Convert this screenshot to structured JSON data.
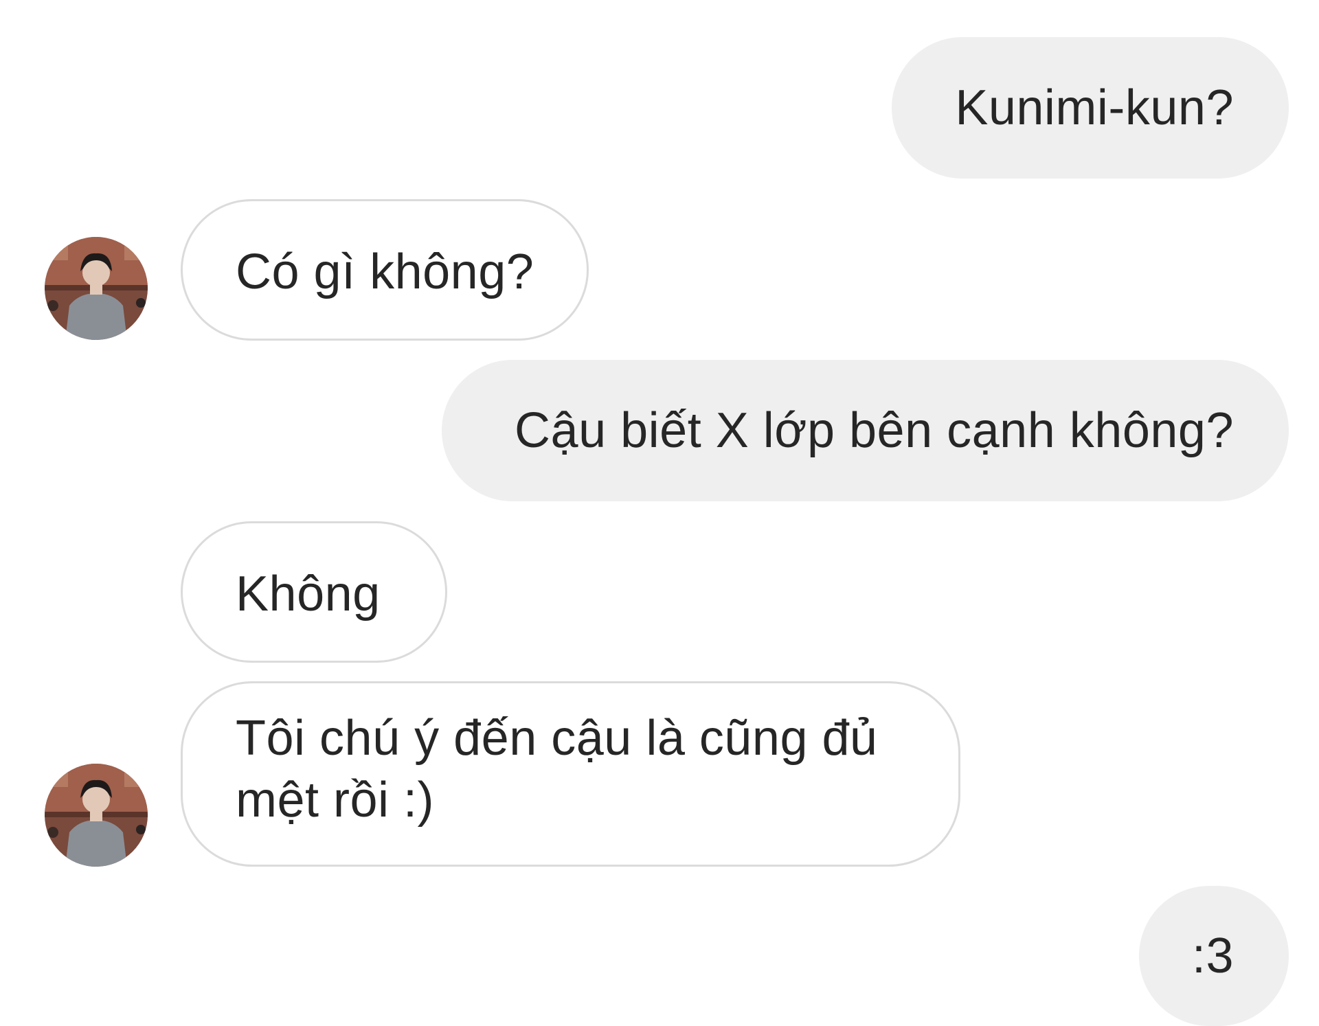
{
  "messages": [
    {
      "sender": "me",
      "text": "Kunimi-kun?"
    },
    {
      "sender": "them",
      "text": "Có gì không?"
    },
    {
      "sender": "me",
      "text": "Cậu biết X lớp bên cạnh không?"
    },
    {
      "sender": "them",
      "text": "Không"
    },
    {
      "sender": "them",
      "text": "Tôi chú ý đến cậu là cũng đủ mệt rồi :)"
    },
    {
      "sender": "me",
      "text": ":3"
    }
  ],
  "colors": {
    "sent_bubble": "#efefef",
    "received_border": "#dbdbdb",
    "text": "#262626",
    "background": "#ffffff"
  },
  "icons": {
    "avatar": "avatar-icon"
  }
}
